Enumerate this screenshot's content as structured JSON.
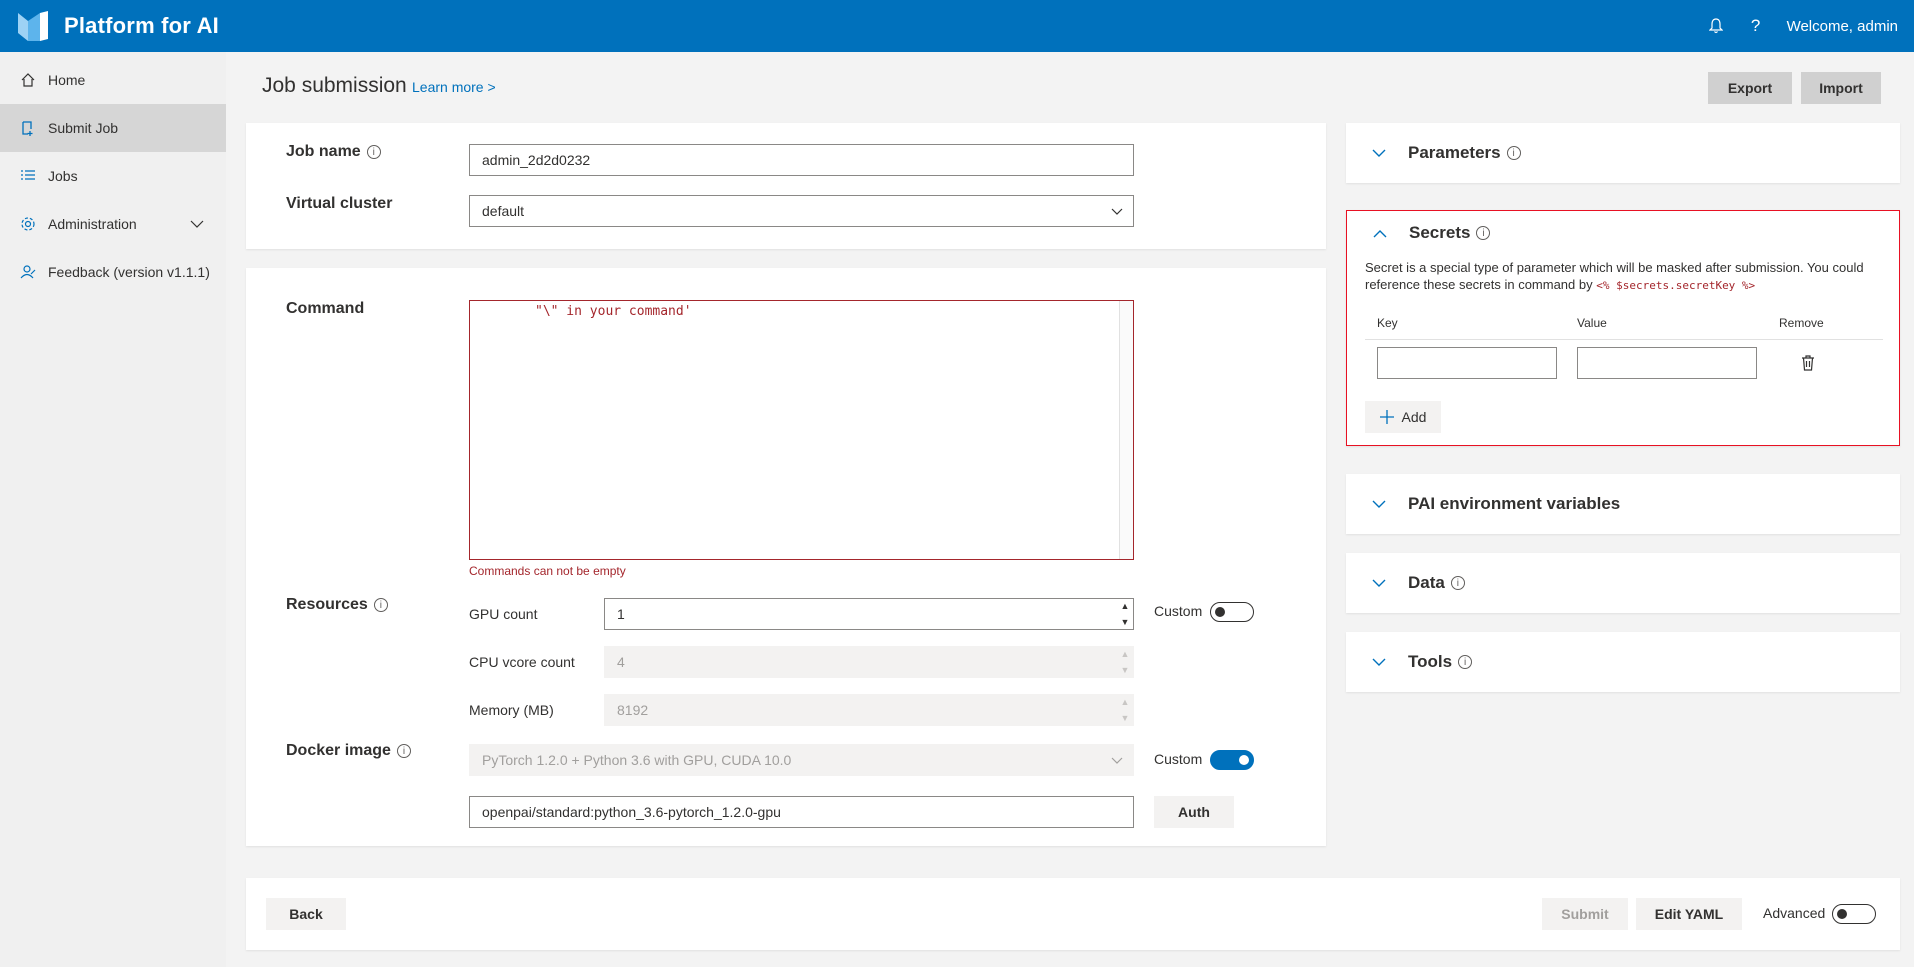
{
  "app": {
    "title": "Platform for AI",
    "welcome": "Welcome, admin",
    "help_icon_text": "?"
  },
  "sidebar": {
    "items": [
      {
        "label": "Home",
        "icon": "home-icon"
      },
      {
        "label": "Submit Job",
        "icon": "submit-job-icon",
        "active": true
      },
      {
        "label": "Jobs",
        "icon": "list-icon"
      },
      {
        "label": "Administration",
        "icon": "settings-icon"
      },
      {
        "label": "Feedback (version v1.1.1)",
        "icon": "feedback-icon"
      }
    ]
  },
  "header": {
    "title": "Job submission",
    "learn_more": "Learn more >",
    "export": "Export",
    "import": "Import"
  },
  "form": {
    "job_name_label": "Job name",
    "job_name_value": "admin_2d2d0232",
    "virtual_cluster_label": "Virtual cluster",
    "virtual_cluster_value": "default",
    "command_label": "Command",
    "command_text": "\"\\\" in your command'",
    "command_error": "Commands can not be empty",
    "resources_label": "Resources",
    "gpu_label": "GPU count",
    "gpu_value": "1",
    "cpu_label": "CPU vcore count",
    "cpu_value": "4",
    "memory_label": "Memory (MB)",
    "memory_value": "8192",
    "custom_label": "Custom",
    "docker_label": "Docker image",
    "docker_value": "PyTorch 1.2.0 + Python 3.6 with GPU, CUDA 10.0",
    "docker_custom_value": "openpai/standard:python_3.6-pytorch_1.2.0-gpu",
    "auth": "Auth"
  },
  "footer": {
    "back": "Back",
    "submit": "Submit",
    "edit_yaml": "Edit YAML",
    "advanced": "Advanced"
  },
  "panels": {
    "parameters": "Parameters",
    "secrets": "Secrets",
    "secrets_desc_1": "Secret is a special type of parameter which will be masked after submission. You could reference these secrets in command by ",
    "secrets_code": "<% $secrets.secretKey %>",
    "key_header": "Key",
    "value_header": "Value",
    "remove_header": "Remove",
    "add": "Add",
    "pai_env": "PAI environment variables",
    "data": "Data",
    "tools": "Tools"
  },
  "colors": {
    "brand": "#0071bc",
    "error": "#a4262c"
  }
}
